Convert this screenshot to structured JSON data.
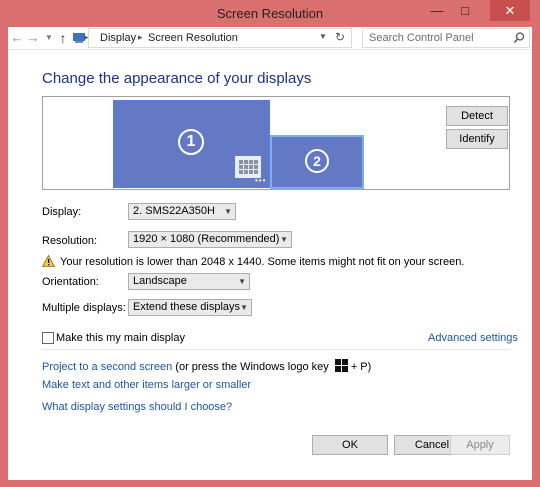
{
  "window": {
    "title": "Screen Resolution"
  },
  "address": {
    "crumbs": [
      "Display",
      "Screen Resolution"
    ],
    "search_placeholder": "Search Control Panel"
  },
  "heading": "Change the appearance of your displays",
  "monitors": [
    {
      "number": "1"
    },
    {
      "number": "2"
    }
  ],
  "buttons": {
    "detect": "Detect",
    "identify": "Identify",
    "ok": "OK",
    "cancel": "Cancel",
    "apply": "Apply"
  },
  "form": {
    "display_label": "Display:",
    "display_value": "2. SMS22A350H",
    "resolution_label": "Resolution:",
    "resolution_value": "1920 × 1080 (Recommended)",
    "warning": "Your resolution is lower than 2048 x 1440. Some items might not fit on your screen.",
    "orientation_label": "Orientation:",
    "orientation_value": "Landscape",
    "multiple_label": "Multiple displays:",
    "multiple_value": "Extend these displays"
  },
  "main_display": {
    "label": "Make this my main display",
    "checked": false
  },
  "links": {
    "advanced": "Advanced settings",
    "project": "Project to a second screen",
    "project_suffix": " (or press the Windows logo key",
    "project_suffix2": "+ P)",
    "larger": "Make text and other items larger or smaller",
    "help": "What display settings should I choose?"
  }
}
